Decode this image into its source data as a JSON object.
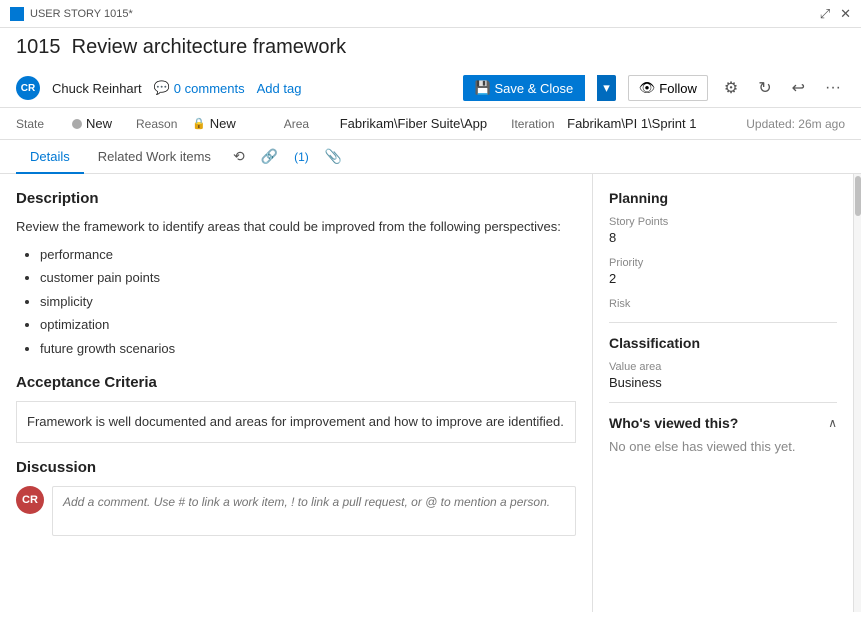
{
  "titleBar": {
    "label": "USER STORY 1015*",
    "expandIcon": "⤢",
    "closeIcon": "✕"
  },
  "workItem": {
    "number": "1015",
    "title": "Review architecture framework"
  },
  "authorBar": {
    "avatarInitials": "CR",
    "authorName": "Chuck Reinhart",
    "commentsIcon": "💬",
    "commentsCount": "0 comments",
    "addTagLabel": "Add tag",
    "saveCloseLabel": "Save & Close",
    "saveCloseIcon": "💾",
    "dropdownArrow": "▾",
    "followIcon": "👁",
    "followLabel": "Follow",
    "gearIcon": "⚙",
    "refreshIcon": "↻",
    "undoIcon": "↩",
    "moreIcon": "···"
  },
  "fields": {
    "stateLabel": "State",
    "stateValue": "New",
    "reasonLabel": "Reason",
    "reasonValue": "New",
    "areaLabel": "Area",
    "areaValue": "Fabrikam\\Fiber Suite\\App",
    "iterationLabel": "Iteration",
    "iterationValue": "Fabrikam\\PI 1\\Sprint 1",
    "updatedText": "Updated: 26m ago"
  },
  "tabs": {
    "details": "Details",
    "relatedWorkItems": "Related Work items",
    "historyIcon": "⟲",
    "linkIcon": "🔗",
    "linkCount": "(1)",
    "attachIcon": "📎"
  },
  "description": {
    "title": "Description",
    "paragraphText": "Review the framework to identify areas that could be improved from the following perspectives:",
    "bullets": [
      "performance",
      "customer pain points",
      "simplicity",
      "optimization",
      "future growth scenarios"
    ]
  },
  "acceptanceCriteria": {
    "title": "Acceptance Criteria",
    "text": "Framework is well documented and areas for improvement and how to improve are identified."
  },
  "discussion": {
    "title": "Discussion",
    "commentAvatarInitials": "CR",
    "commentPlaceholder": "Add a comment. Use # to link a work item, ! to link a pull request, or @ to mention a person."
  },
  "planning": {
    "title": "Planning",
    "storyPointsLabel": "Story Points",
    "storyPointsValue": "8",
    "priorityLabel": "Priority",
    "priorityValue": "2",
    "riskLabel": "Risk",
    "riskValue": ""
  },
  "classification": {
    "title": "Classification",
    "valueAreaLabel": "Value area",
    "valueAreaValue": "Business"
  },
  "whosViewed": {
    "title": "Who's viewed this?",
    "collapseIcon": "∧",
    "noViewersText": "No one else has viewed this yet."
  }
}
